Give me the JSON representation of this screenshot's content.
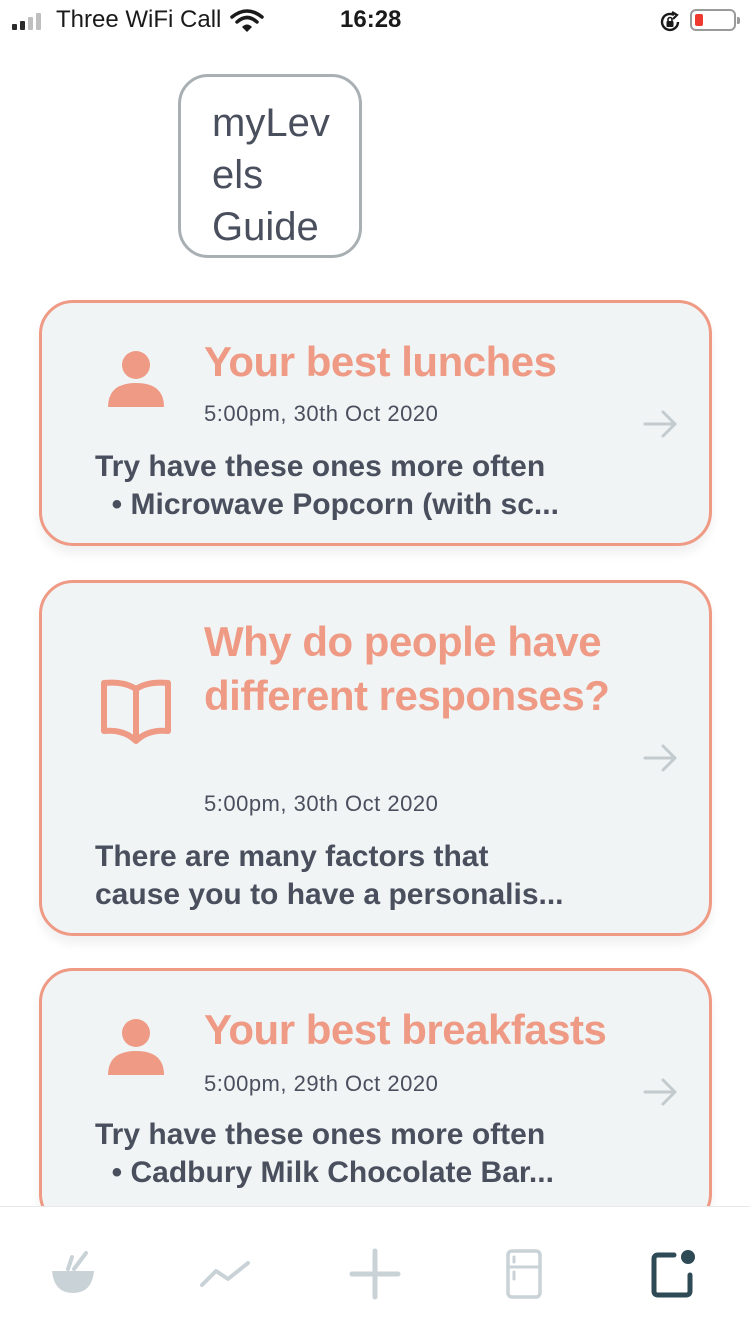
{
  "status_bar": {
    "carrier": "Three WiFi Call",
    "time": "16:28",
    "icons": [
      "signal-icon",
      "wifi-icon",
      "rotation-lock-icon",
      "battery-low-icon"
    ]
  },
  "header": {
    "logo_lines": [
      "myLev",
      "els",
      "Guide"
    ]
  },
  "cards": [
    {
      "icon": "person-icon",
      "title": "Your best lunches",
      "time": "5:00pm, 30th Oct 2020",
      "body_lines": [
        "Try have these ones more often",
        "  • Microwave Popcorn (with sc..."
      ]
    },
    {
      "icon": "book-icon",
      "title": "Why do people have different responses?",
      "time": "5:00pm, 30th Oct 2020",
      "body_lines": [
        "There are many factors that",
        "cause you to have a personalis..."
      ]
    },
    {
      "icon": "person-icon",
      "title": "Your best breakfasts",
      "time": "5:00pm, 29th Oct 2020",
      "body_lines": [
        "Try have these ones more often",
        "  • Cadbury Milk Chocolate Bar..."
      ]
    }
  ],
  "tab_bar": {
    "tabs": [
      "food-bowl-icon",
      "trend-line-icon",
      "add-icon",
      "fridge-icon",
      "guide-notification-icon"
    ],
    "active": "guide-notification-icon"
  },
  "colors": {
    "accent": "#ee9a84",
    "text": "#4a4f5e",
    "card_bg": "#f1f4f5",
    "inactive_icon": "#c9d2d6",
    "active_icon": "#2d4a55"
  }
}
